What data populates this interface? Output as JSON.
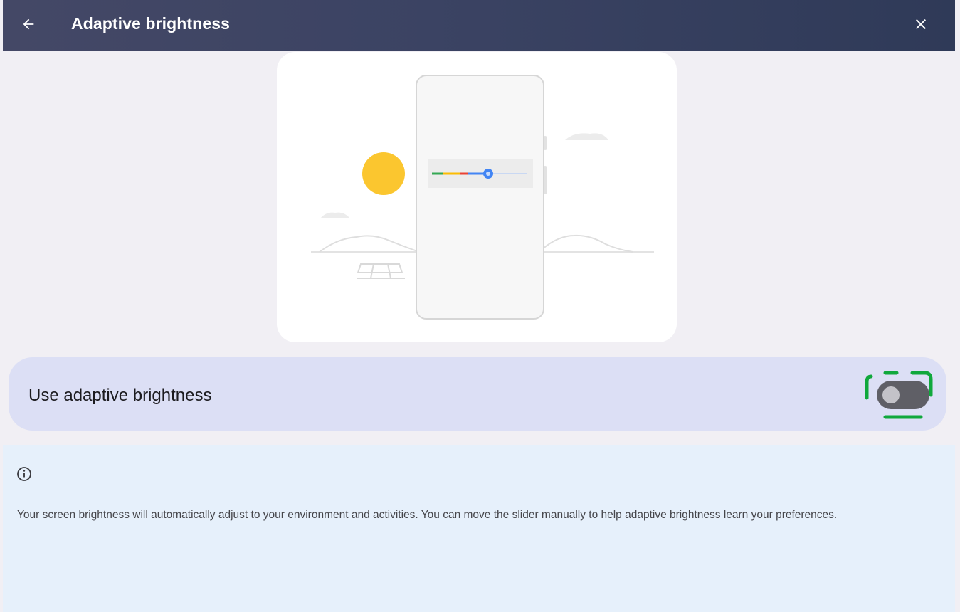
{
  "header": {
    "title": "Adaptive brightness",
    "back_icon": "arrow-back-icon",
    "close_icon": "close-icon"
  },
  "illustration": {
    "description_icons": [
      "sun-icon",
      "phone-icon",
      "brightness-slider-icon",
      "cloud-icon",
      "bench-icon"
    ],
    "slider_level": 0.5,
    "sun_color": "#fbc62f",
    "slider_colors": [
      "#34a853",
      "#fbbc04",
      "#ea4335",
      "#4285f4"
    ]
  },
  "setting": {
    "label": "Use adaptive brightness",
    "enabled": false,
    "highlight_color": "#10a83c"
  },
  "info": {
    "icon": "info-icon",
    "text": "Your screen brightness will automatically adjust to your environment and activities. You can move the slider manually to help adaptive brightness learn your preferences."
  },
  "colors": {
    "header_bg": "#3b4363",
    "page_bg": "#f1eff4",
    "row_bg": "#dcdff5",
    "info_bg": "#e6f0fb"
  }
}
